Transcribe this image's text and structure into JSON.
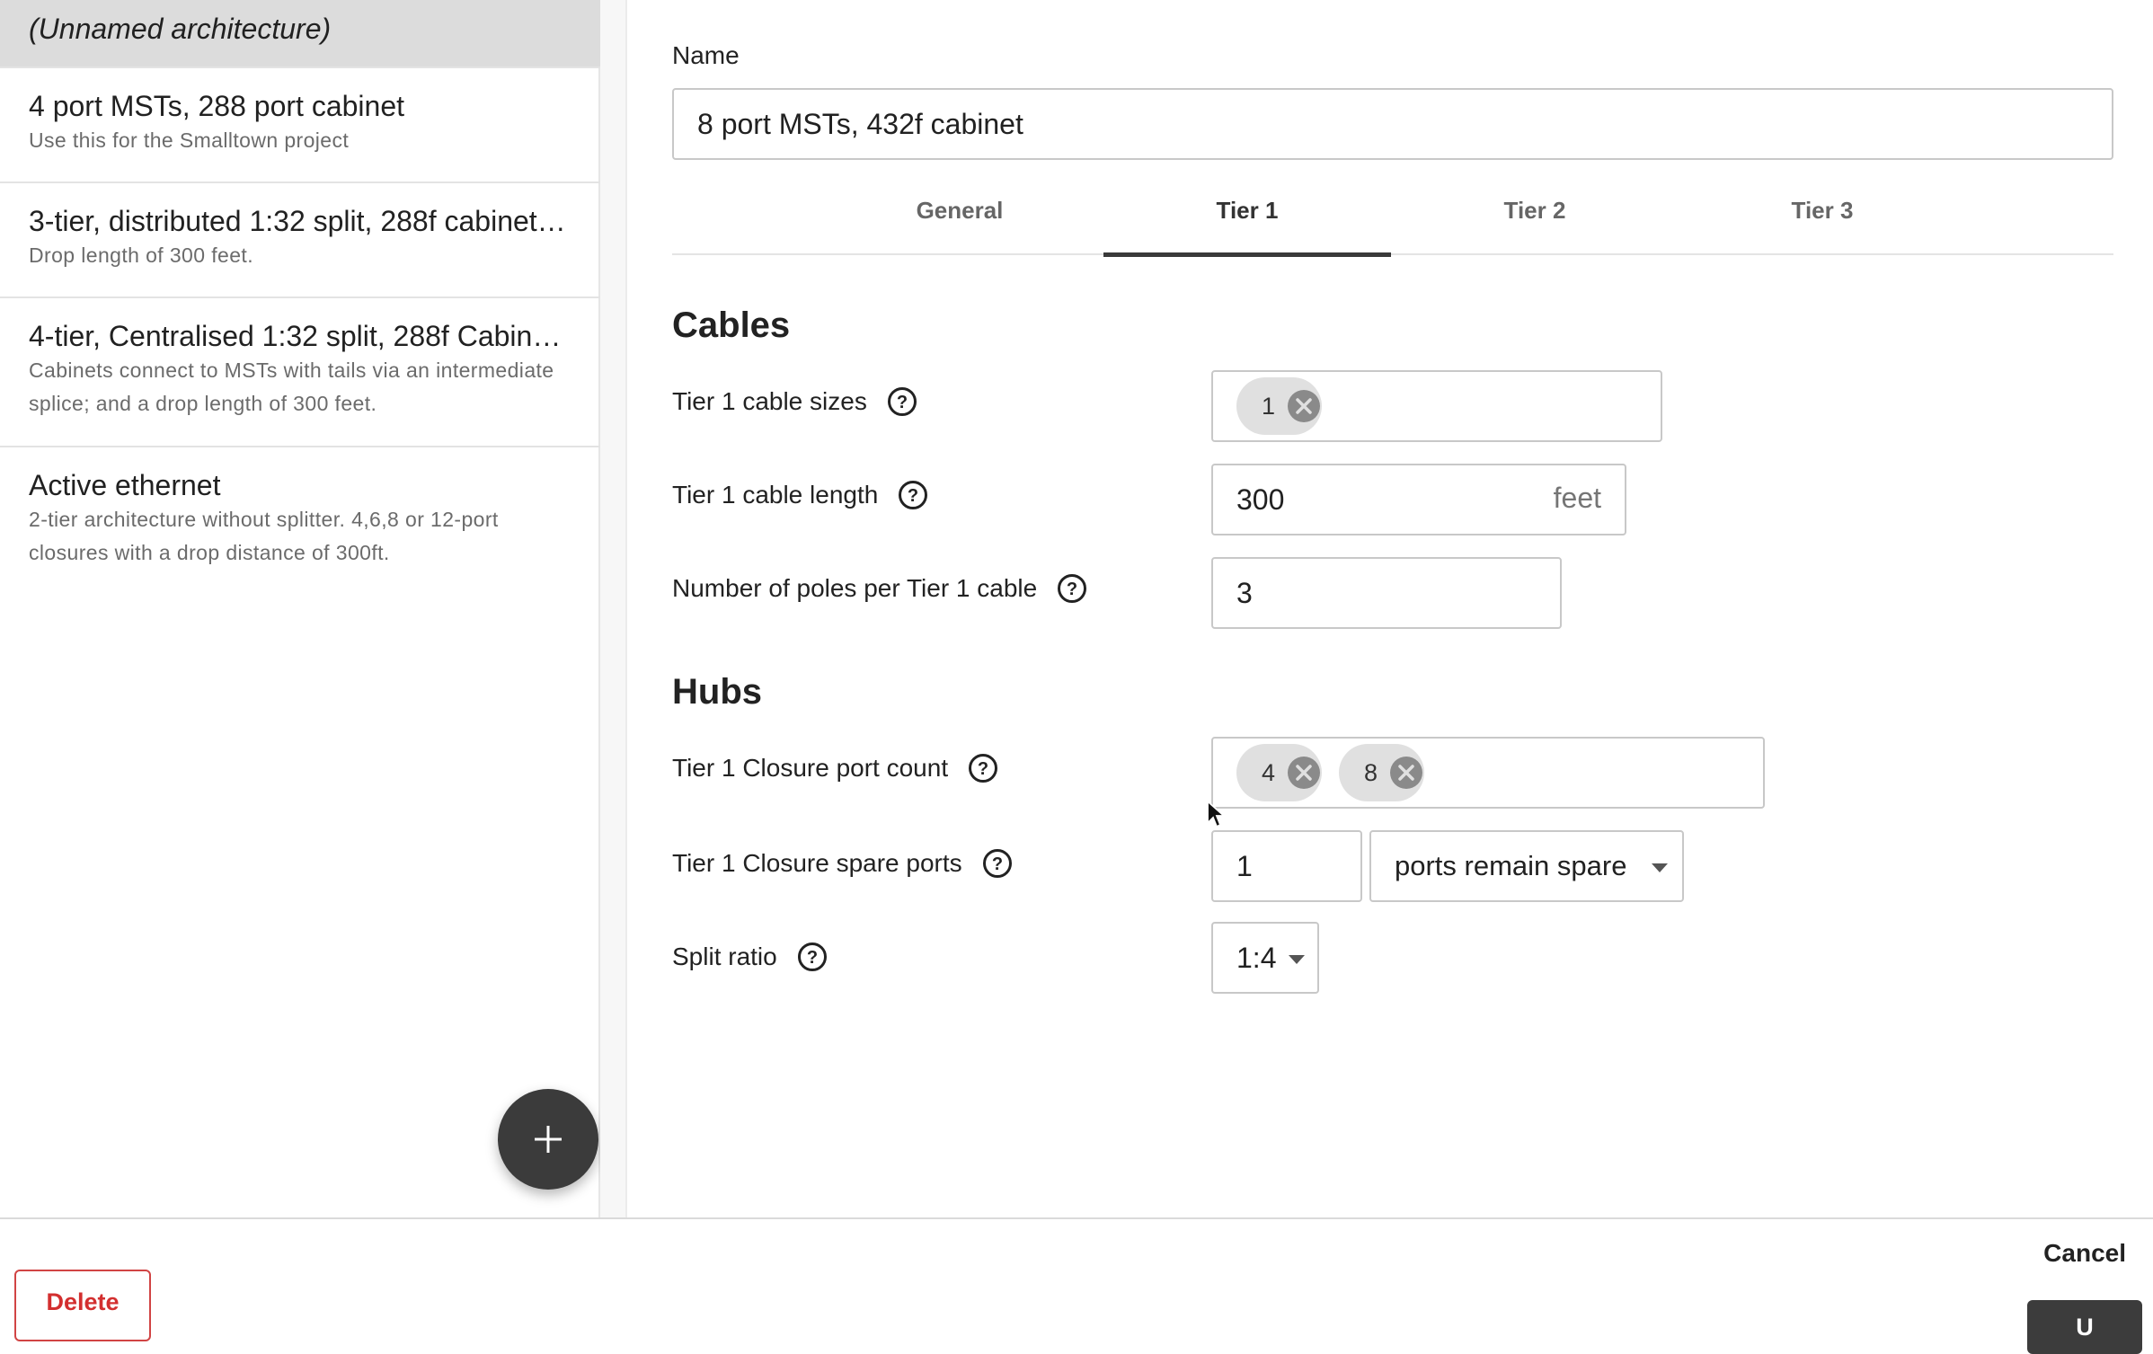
{
  "sidebar": {
    "items": [
      {
        "title": "(Unnamed architecture)",
        "desc": ""
      },
      {
        "title": "4 port MSTs, 288 port cabinet",
        "desc": "Use this for the Smalltown project"
      },
      {
        "title": "3-tier, distributed 1:32 split, 288f cabinet…",
        "desc": "Drop length of 300 feet."
      },
      {
        "title": "4-tier, Centralised 1:32 split, 288f Cabine…",
        "desc": "Cabinets connect to MSTs with tails via an intermediate splice; and a drop length of 300 feet."
      },
      {
        "title": "Active ethernet",
        "desc": "2-tier architecture without splitter. 4,6,8 or 12-port closures with a drop distance of 300ft."
      }
    ],
    "fab_icon": "plus-icon"
  },
  "form": {
    "name_label": "Name",
    "name_value": "8 port MSTs, 432f cabinet",
    "tabs": [
      "General",
      "Tier 1",
      "Tier 2",
      "Tier 3"
    ],
    "active_tab": "Tier 1",
    "cables": {
      "section_title": "Cables",
      "cable_sizes_label": "Tier 1 cable sizes",
      "cable_sizes": [
        "1"
      ],
      "cable_length_label": "Tier 1 cable length",
      "cable_length_value": "300",
      "cable_length_unit": "feet",
      "poles_label": "Number of poles per Tier 1 cable",
      "poles_value": "3"
    },
    "hubs": {
      "section_title": "Hubs",
      "port_count_label": "Tier 1 Closure port count",
      "port_counts": [
        "4",
        "8"
      ],
      "spare_ports_label": "Tier 1 Closure spare ports",
      "spare_ports_value": "1",
      "spare_ports_mode": "ports remain spare",
      "split_ratio_label": "Split ratio",
      "split_ratio_value": "1:4"
    }
  },
  "footer": {
    "delete_label": "Delete",
    "cancel_label": "Cancel",
    "save_label": "U"
  },
  "colors": {
    "delete": "#d32f2f",
    "fab": "#3b3b3b",
    "selected_item": "#dcdcdc"
  }
}
